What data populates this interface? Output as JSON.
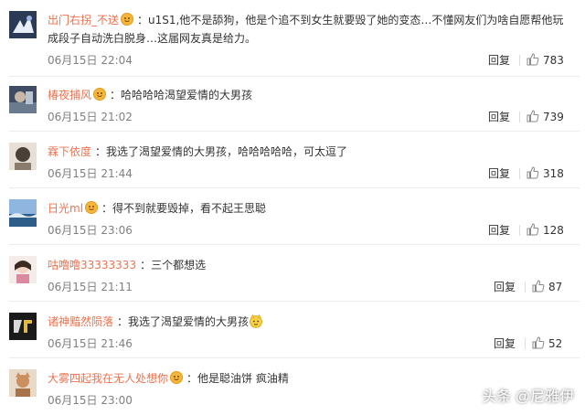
{
  "comments": [
    {
      "user": "出门右拐_不送",
      "separator": "：",
      "text": "u1S1,他不是舔狗，他是个追不到女生就要毁了她的变态…不懂网友们为啥自愿帮他玩成段子自动洗白脱身…这届网友真是给力。",
      "time": "06月15日 22:04",
      "reply_label": "回复",
      "likes": "783"
    },
    {
      "user": "椿夜捕风",
      "separator": "：",
      "text": "哈哈哈哈渴望爱情的大男孩",
      "time": "06月15日 21:02",
      "reply_label": "回复",
      "likes": "739"
    },
    {
      "user": "霖下依度",
      "separator": "：",
      "text": "我选了渴望爱情的大男孩，哈哈哈哈哈，可太逗了",
      "time": "06月15日 21:44",
      "reply_label": "回复",
      "likes": "318"
    },
    {
      "user": "日光ml",
      "separator": "：",
      "text": "得不到就要毁掉，看不起王思聪",
      "time": "06月15日 23:06",
      "reply_label": "回复",
      "likes": "128"
    },
    {
      "user": "咕噜噜33333333",
      "separator": "：",
      "text": "三个都想选",
      "time": "06月15日 21:11",
      "reply_label": "回复",
      "likes": "87"
    },
    {
      "user": "诸神黯然陨落",
      "separator": "：",
      "text": "我选了渴望爱情的大男孩",
      "time": "06月15日 21:46",
      "reply_label": "回复",
      "likes": "52"
    },
    {
      "user": "大雾四起我在无人处想你",
      "separator": "：",
      "text": "他是聪油饼 疯油精",
      "time": "06月15日 23:00",
      "reply_label": "",
      "likes": ""
    }
  ],
  "watermark": "头条 @尼雅伊",
  "colors": {
    "username": "#eb7350",
    "meta": "#808080",
    "divider": "#ececec"
  }
}
